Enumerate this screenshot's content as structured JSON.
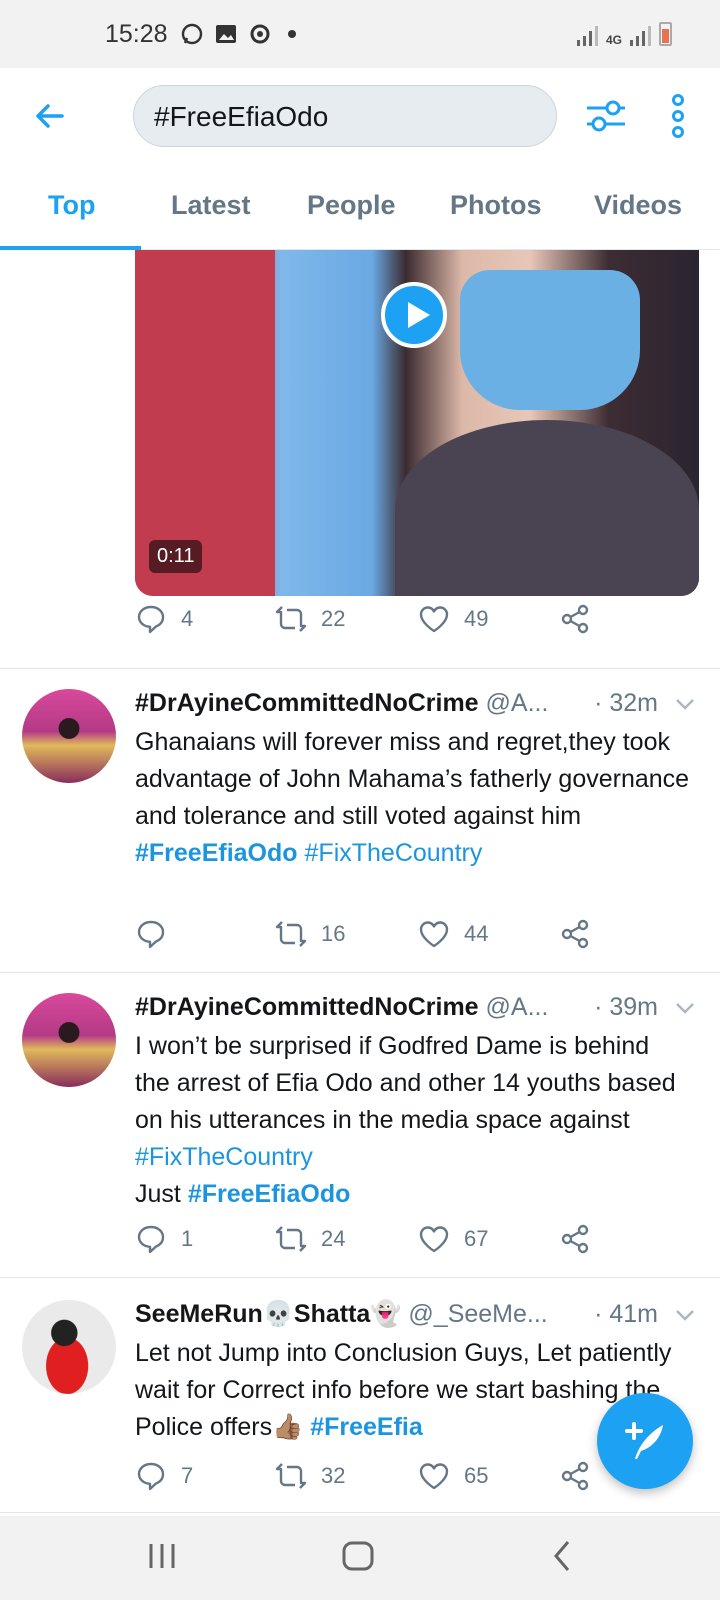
{
  "status_bar": {
    "time": "15:28",
    "network": "4G"
  },
  "search": {
    "query": "#FreeEfiaOdo"
  },
  "tabs": [
    {
      "label": "Top",
      "active": true
    },
    {
      "label": "Latest"
    },
    {
      "label": "People"
    },
    {
      "label": "Photos"
    },
    {
      "label": "Videos"
    }
  ],
  "video_tweet": {
    "duration": "0:11",
    "replies": "4",
    "retweets": "22",
    "likes": "49"
  },
  "tweets": [
    {
      "name": "#DrAyineCommittedNoCrime",
      "handle": "@A...",
      "time": "· 32m",
      "text": "Ghanaians will forever miss and regret,they took advantage of John Mahama’s fatherly governance and tolerance and still voted against him",
      "tag1": "#FreeEfiaOdo",
      "tag2": "#FixTheCountry",
      "replies": "",
      "retweets": "16",
      "likes": "44"
    },
    {
      "name": "#DrAyineCommittedNoCrime",
      "handle": "@A...",
      "time": "· 39m",
      "text": "I won’t be surprised if Godfred Dame is behind the arrest of Efia Odo and other 14 youths based on his utterances in the media space against",
      "tag1": "#FixTheCountry",
      "text2": "Just",
      "tag2": "#FreeEfiaOdo",
      "replies": "1",
      "retweets": "24",
      "likes": "67"
    },
    {
      "name": "SeeMeRun💀Shatta👻",
      "handle": "@_SeeMe...",
      "time": "· 41m",
      "text": "Let not Jump into Conclusion Guys, Let patiently wait for Correct info before we start bashing the Police offers👍🏽",
      "tag1": "#FreeEfia",
      "replies": "7",
      "retweets": "32",
      "likes": "65"
    }
  ],
  "colors": {
    "accent": "#1da1f2",
    "link": "#1b95e0",
    "muted": "#657786"
  }
}
